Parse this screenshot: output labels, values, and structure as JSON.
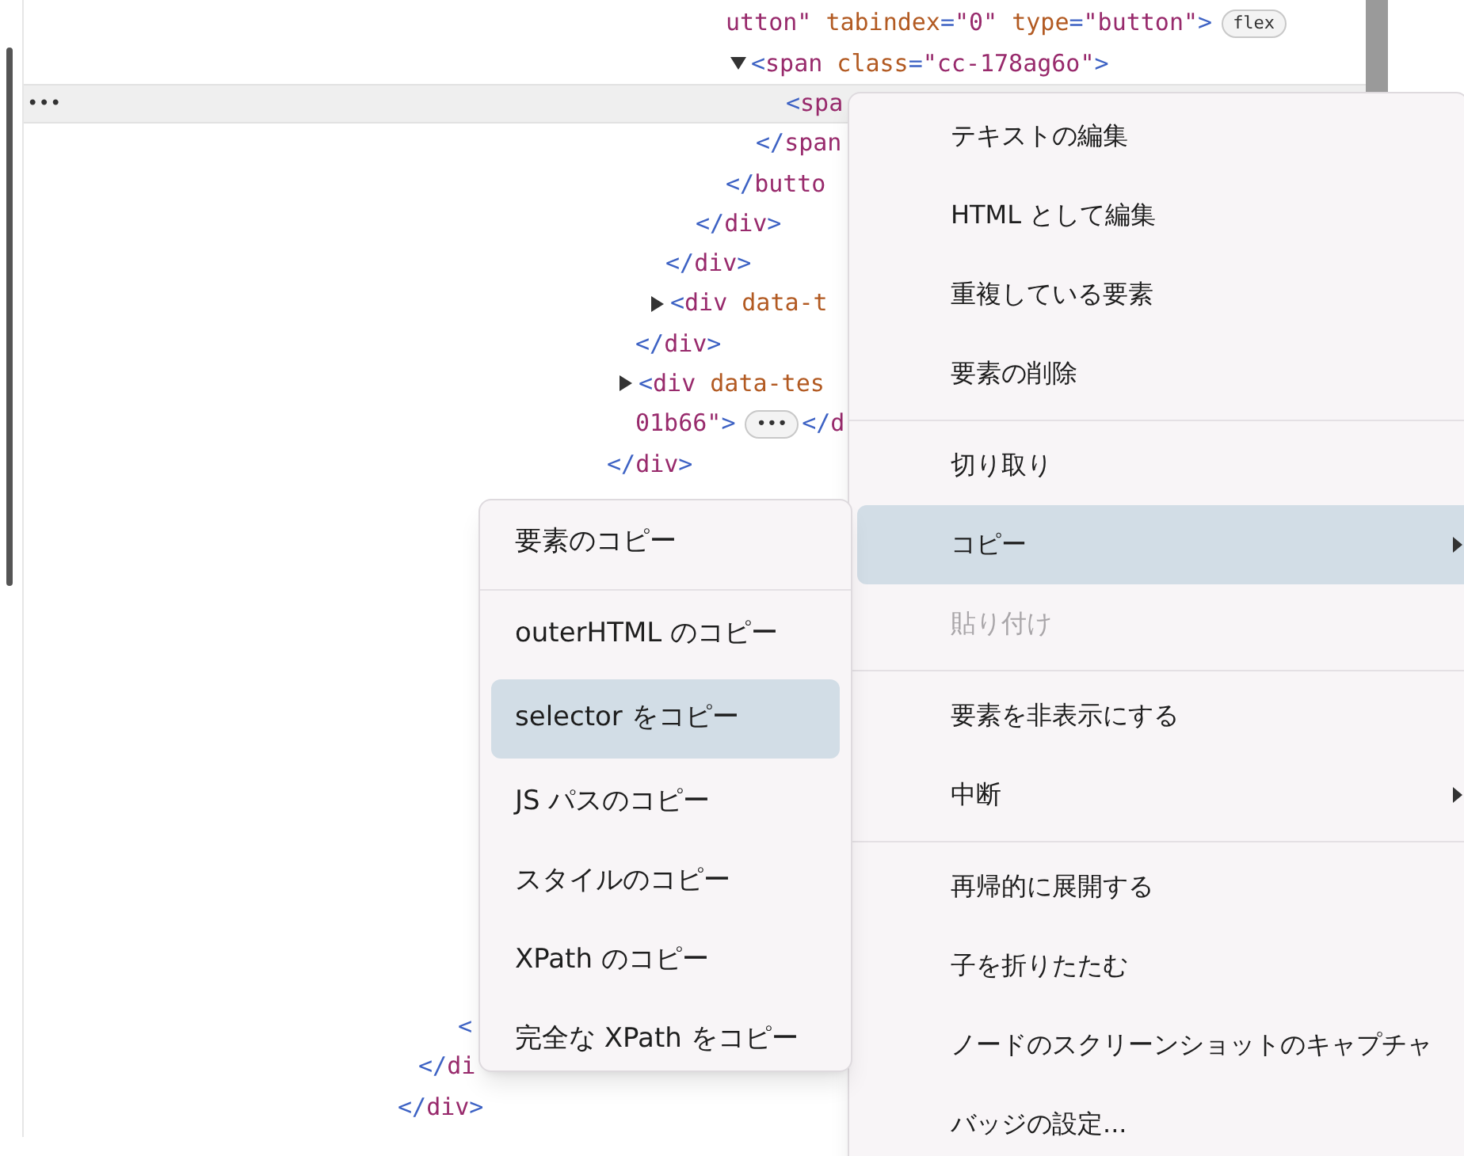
{
  "code_lines": [
    {
      "selected": false,
      "segments": [
        {
          "kind": "value",
          "text": "utton\""
        },
        {
          "kind": "attr",
          "text": " tabindex"
        },
        {
          "kind": "punct",
          "text": "="
        },
        {
          "kind": "value",
          "text": "\"0\""
        },
        {
          "kind": "attr",
          "text": " type"
        },
        {
          "kind": "punct",
          "text": "="
        },
        {
          "kind": "value",
          "text": "\"button\""
        },
        {
          "kind": "punct",
          "text": ">"
        }
      ],
      "badge": "flex"
    },
    {
      "selected": false,
      "expanded": true,
      "segments": [
        {
          "kind": "punct",
          "text": "<"
        },
        {
          "kind": "tag",
          "text": "span"
        },
        {
          "kind": "attr",
          "text": " class"
        },
        {
          "kind": "punct",
          "text": "="
        },
        {
          "kind": "value",
          "text": "\"cc-178ag6o\""
        },
        {
          "kind": "punct",
          "text": ">"
        }
      ]
    },
    {
      "selected": true,
      "gutter": "•••",
      "segments": [
        {
          "kind": "punct",
          "text": "<"
        },
        {
          "kind": "tag",
          "text": "spa"
        }
      ]
    },
    {
      "selected": false,
      "segments": [
        {
          "kind": "punct",
          "text": "</"
        },
        {
          "kind": "tag",
          "text": "span"
        }
      ]
    },
    {
      "selected": false,
      "segments": [
        {
          "kind": "punct",
          "text": "</"
        },
        {
          "kind": "tag",
          "text": "butto"
        }
      ]
    },
    {
      "selected": false,
      "segments": [
        {
          "kind": "punct",
          "text": "</"
        },
        {
          "kind": "tag",
          "text": "div"
        },
        {
          "kind": "punct",
          "text": ">"
        }
      ]
    },
    {
      "selected": false,
      "segments": [
        {
          "kind": "punct",
          "text": "</"
        },
        {
          "kind": "tag",
          "text": "div"
        },
        {
          "kind": "punct",
          "text": ">"
        }
      ]
    },
    {
      "selected": false,
      "expanded": false,
      "segments": [
        {
          "kind": "punct",
          "text": "<"
        },
        {
          "kind": "tag",
          "text": "div"
        },
        {
          "kind": "attr",
          "text": " data-t"
        }
      ]
    },
    {
      "selected": false,
      "segments": [
        {
          "kind": "punct",
          "text": "</"
        },
        {
          "kind": "tag",
          "text": "div"
        },
        {
          "kind": "punct",
          "text": ">"
        }
      ]
    },
    {
      "selected": false,
      "expanded": false,
      "segments": [
        {
          "kind": "punct",
          "text": "<"
        },
        {
          "kind": "tag",
          "text": "div"
        },
        {
          "kind": "attr",
          "text": " data-tes"
        }
      ]
    },
    {
      "selected": false,
      "segments": [
        {
          "kind": "value",
          "text": "01b66\""
        },
        {
          "kind": "punct",
          "text": ">"
        }
      ],
      "badge": "•••",
      "after": [
        {
          "kind": "punct",
          "text": "</"
        },
        {
          "kind": "tag",
          "text": "d"
        }
      ]
    },
    {
      "selected": false,
      "segments": [
        {
          "kind": "punct",
          "text": "</"
        },
        {
          "kind": "tag",
          "text": "div"
        },
        {
          "kind": "punct",
          "text": ">"
        }
      ]
    },
    {
      "selected": false,
      "segments": [
        {
          "kind": "punct",
          "text": "<"
        }
      ]
    },
    {
      "selected": false,
      "segments": [
        {
          "kind": "punct",
          "text": "</"
        },
        {
          "kind": "tag",
          "text": "di"
        }
      ]
    },
    {
      "selected": false,
      "segments": [
        {
          "kind": "punct",
          "text": "</"
        },
        {
          "kind": "tag",
          "text": "div"
        },
        {
          "kind": "punct",
          "text": ">"
        }
      ]
    }
  ],
  "context_menu": {
    "items": [
      {
        "kind": "item",
        "label": "テキストの編集",
        "selected": false,
        "disabled": false,
        "submenu": false
      },
      {
        "kind": "item",
        "label": "HTML として編集",
        "selected": false,
        "disabled": false,
        "submenu": false
      },
      {
        "kind": "item",
        "label": "重複している要素",
        "selected": false,
        "disabled": false,
        "submenu": false
      },
      {
        "kind": "item",
        "label": "要素の削除",
        "selected": false,
        "disabled": false,
        "submenu": false
      },
      {
        "kind": "separator"
      },
      {
        "kind": "item",
        "label": "切り取り",
        "selected": false,
        "disabled": false,
        "submenu": false
      },
      {
        "kind": "item",
        "label": "コピー",
        "selected": true,
        "disabled": false,
        "submenu": true
      },
      {
        "kind": "item",
        "label": "貼り付け",
        "selected": false,
        "disabled": true,
        "submenu": false
      },
      {
        "kind": "separator"
      },
      {
        "kind": "item",
        "label": "要素を非表示にする",
        "selected": false,
        "disabled": false,
        "submenu": false
      },
      {
        "kind": "item",
        "label": "中断",
        "selected": false,
        "disabled": false,
        "submenu": true
      },
      {
        "kind": "separator"
      },
      {
        "kind": "item",
        "label": "再帰的に展開する",
        "selected": false,
        "disabled": false,
        "submenu": false
      },
      {
        "kind": "item",
        "label": "子を折りたたむ",
        "selected": false,
        "disabled": false,
        "submenu": false
      },
      {
        "kind": "item",
        "label": "ノードのスクリーンショットのキャプチャ",
        "selected": false,
        "disabled": false,
        "submenu": false
      },
      {
        "kind": "item",
        "label": "バッジの設定...",
        "selected": false,
        "disabled": false,
        "submenu": false
      }
    ]
  },
  "copy_submenu": {
    "items": [
      {
        "kind": "item",
        "label": "要素のコピー",
        "selected": false
      },
      {
        "kind": "separator"
      },
      {
        "kind": "item",
        "label": "outerHTML のコピー",
        "selected": false
      },
      {
        "kind": "item",
        "label": "selector をコピー",
        "selected": true
      },
      {
        "kind": "item",
        "label": "JS パスのコピー",
        "selected": false
      },
      {
        "kind": "item",
        "label": "スタイルのコピー",
        "selected": false
      },
      {
        "kind": "item",
        "label": "XPath のコピー",
        "selected": false
      },
      {
        "kind": "item",
        "label": "完全な XPath をコピー",
        "selected": false
      }
    ]
  }
}
